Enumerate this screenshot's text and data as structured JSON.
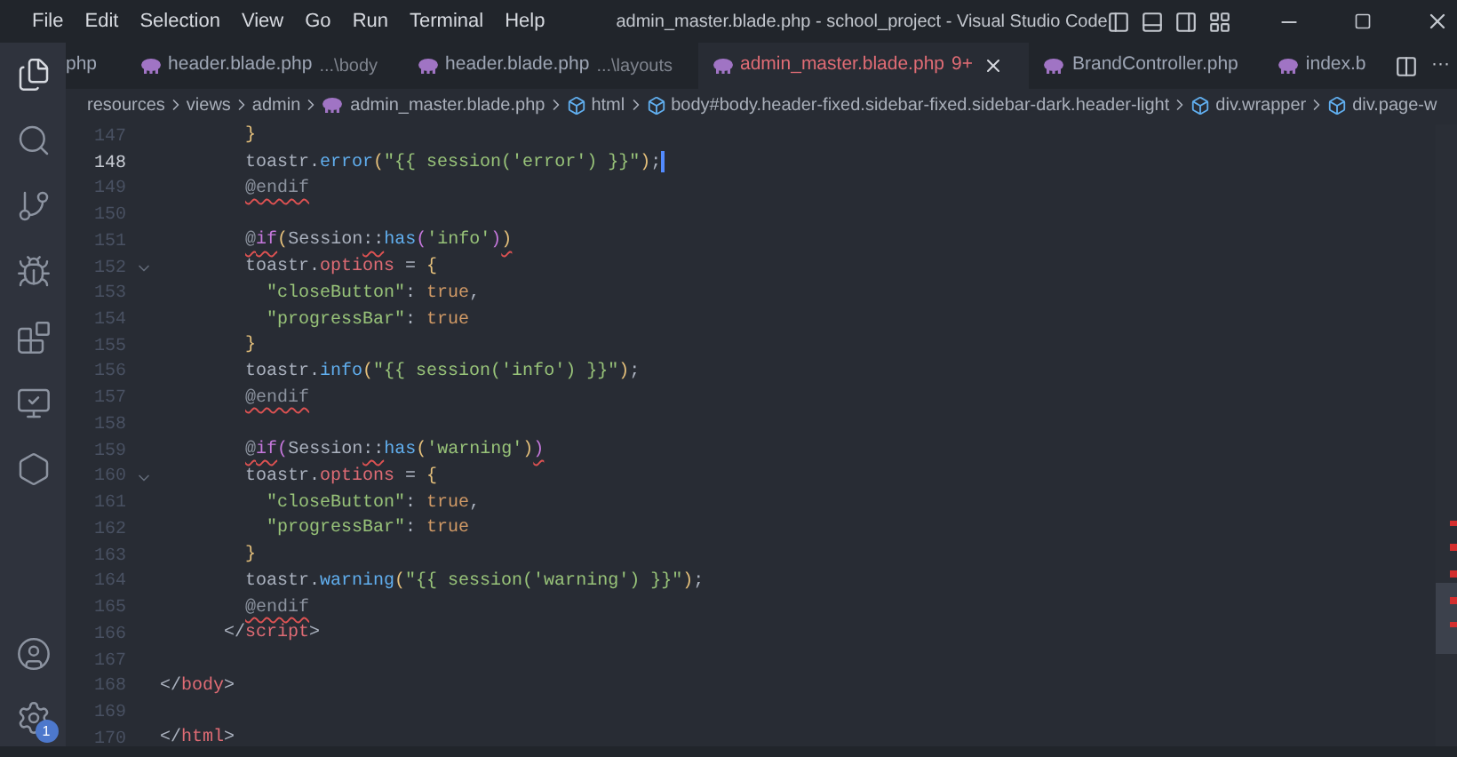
{
  "menu": [
    "File",
    "Edit",
    "Selection",
    "View",
    "Go",
    "Run",
    "Terminal",
    "Help"
  ],
  "window": {
    "title": "admin_master.blade.php - school_project - Visual Studio Code"
  },
  "activity_bar": {
    "settings_badge": "1"
  },
  "tabs": [
    {
      "label": "php",
      "selected": false
    },
    {
      "label": "header.blade.php",
      "path": "...\\body",
      "selected": false
    },
    {
      "label": "header.blade.php",
      "path": "...\\layouts",
      "selected": false
    },
    {
      "label": "admin_master.blade.php",
      "problems": "9+",
      "selected": true
    },
    {
      "label": "BrandController.php",
      "selected": false
    },
    {
      "label": "index.b",
      "selected": false
    }
  ],
  "tab_actions": {
    "more": "···"
  },
  "breadcrumb": [
    {
      "label": "resources",
      "kind": "folder"
    },
    {
      "label": "views",
      "kind": "folder"
    },
    {
      "label": "admin",
      "kind": "folder"
    },
    {
      "label": "admin_master.blade.php",
      "kind": "file"
    },
    {
      "label": "html",
      "kind": "element"
    },
    {
      "label": "body#body.header-fixed.sidebar-fixed.sidebar-dark.header-light",
      "kind": "element"
    },
    {
      "label": "div.wrapper",
      "kind": "element"
    },
    {
      "label": "div.page-w",
      "kind": "element"
    }
  ],
  "code": [
    {
      "number": "147",
      "selected": false,
      "tokens": [
        {
          "text": "        }",
          "kind": "brace"
        }
      ]
    },
    {
      "number": "148",
      "selected": true,
      "tokens": [
        {
          "text": "        toastr."
        },
        {
          "text": "error",
          "kind": "method"
        },
        {
          "text": "(",
          "kind": "brace"
        },
        {
          "text": "\"{{ session('error') }}\"",
          "kind": "string"
        },
        {
          "text": ")",
          "kind": "brace"
        },
        {
          "text": ";"
        }
      ]
    },
    {
      "number": "149",
      "selected": false,
      "tokens": [
        {
          "text": "        @endif",
          "kind": "directive",
          "error": true
        }
      ]
    },
    {
      "number": "150",
      "selected": false
    },
    {
      "number": "151",
      "selected": false,
      "tokens": [
        {
          "text": "        @",
          "kind": "directive",
          "error": true
        },
        {
          "text": "if",
          "kind": "keyword",
          "error": true
        },
        {
          "text": "(",
          "kind": "brace"
        },
        {
          "text": "Session"
        },
        {
          "text": "::",
          "error": true
        },
        {
          "text": "has",
          "kind": "method"
        },
        {
          "text": "(",
          "kind": "paren2"
        },
        {
          "text": "'info'",
          "kind": "string"
        },
        {
          "text": ")",
          "kind": "paren2"
        },
        {
          "text": ")",
          "kind": "brace",
          "error": true
        }
      ]
    },
    {
      "number": "152",
      "selected": false,
      "folding": true,
      "tokens": [
        {
          "text": "        toastr."
        },
        {
          "text": "options",
          "kind": "property"
        },
        {
          "text": " = "
        },
        {
          "text": "{",
          "kind": "brace"
        }
      ]
    },
    {
      "number": "153",
      "selected": false,
      "tokens": [
        {
          "text": "          \"closeButton\"",
          "kind": "string"
        },
        {
          "text": ": "
        },
        {
          "text": "true",
          "kind": "constant"
        },
        {
          "text": ","
        }
      ]
    },
    {
      "number": "154",
      "selected": false,
      "tokens": [
        {
          "text": "          \"progressBar\"",
          "kind": "string"
        },
        {
          "text": ": "
        },
        {
          "text": "true",
          "kind": "constant"
        }
      ]
    },
    {
      "number": "155",
      "selected": false,
      "tokens": [
        {
          "text": "        }",
          "kind": "brace"
        }
      ]
    },
    {
      "number": "156",
      "selected": false,
      "tokens": [
        {
          "text": "        toastr."
        },
        {
          "text": "info",
          "kind": "method"
        },
        {
          "text": "(",
          "kind": "brace"
        },
        {
          "text": "\"{{ session('info') }}\"",
          "kind": "string"
        },
        {
          "text": ")",
          "kind": "brace"
        },
        {
          "text": ";"
        }
      ]
    },
    {
      "number": "157",
      "selected": false,
      "tokens": [
        {
          "text": "        @endif",
          "kind": "directive",
          "error": true
        }
      ]
    },
    {
      "number": "158",
      "selected": false
    },
    {
      "number": "159",
      "selected": false,
      "tokens": [
        {
          "text": "        @",
          "kind": "directive",
          "error": true
        },
        {
          "text": "if",
          "kind": "keyword",
          "error": true
        },
        {
          "text": "(",
          "kind": "paren2"
        },
        {
          "text": "Session"
        },
        {
          "text": "::",
          "error": true
        },
        {
          "text": "has",
          "kind": "method"
        },
        {
          "text": "(",
          "kind": "brace"
        },
        {
          "text": "'warning'",
          "kind": "string"
        },
        {
          "text": ")",
          "kind": "brace"
        },
        {
          "text": ")",
          "kind": "paren2",
          "error": true
        }
      ]
    },
    {
      "number": "160",
      "selected": false,
      "folding": true,
      "tokens": [
        {
          "text": "        toastr."
        },
        {
          "text": "options",
          "kind": "property"
        },
        {
          "text": " = "
        },
        {
          "text": "{",
          "kind": "brace"
        }
      ]
    },
    {
      "number": "161",
      "selected": false,
      "tokens": [
        {
          "text": "          \"closeButton\"",
          "kind": "string"
        },
        {
          "text": ": "
        },
        {
          "text": "true",
          "kind": "constant"
        },
        {
          "text": ","
        }
      ]
    },
    {
      "number": "162",
      "selected": false,
      "tokens": [
        {
          "text": "          \"progressBar\"",
          "kind": "string"
        },
        {
          "text": ": "
        },
        {
          "text": "true",
          "kind": "constant"
        }
      ]
    },
    {
      "number": "163",
      "selected": false,
      "tokens": [
        {
          "text": "        }",
          "kind": "brace"
        }
      ]
    },
    {
      "number": "164",
      "selected": false,
      "tokens": [
        {
          "text": "        toastr."
        },
        {
          "text": "warning",
          "kind": "method"
        },
        {
          "text": "(",
          "kind": "brace"
        },
        {
          "text": "\"{{ session('warning') }}\"",
          "kind": "string"
        },
        {
          "text": ")",
          "kind": "brace"
        },
        {
          "text": ";"
        }
      ]
    },
    {
      "number": "165",
      "selected": false,
      "tokens": [
        {
          "text": "        @endif",
          "kind": "directive",
          "error": true
        }
      ]
    },
    {
      "number": "166",
      "selected": false,
      "tokens": [
        {
          "text": "      </"
        },
        {
          "text": "script",
          "kind": "tag"
        },
        {
          "text": ">"
        }
      ]
    },
    {
      "number": "167",
      "selected": false
    },
    {
      "number": "168",
      "selected": false,
      "tokens": [
        {
          "text": "</"
        },
        {
          "text": "body",
          "kind": "tag"
        },
        {
          "text": ">"
        }
      ]
    },
    {
      "number": "169",
      "selected": false
    },
    {
      "number": "170",
      "selected": false,
      "tokens": [
        {
          "text": "</"
        },
        {
          "text": "html",
          "kind": "tag"
        },
        {
          "text": ">"
        }
      ]
    }
  ]
}
